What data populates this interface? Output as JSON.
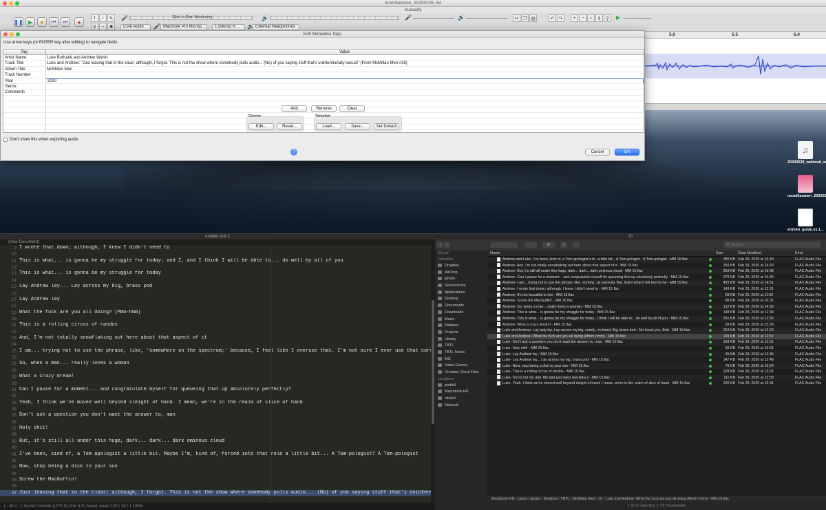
{
  "desktop": {
    "icons": [
      {
        "label": "20200229_waltwait_wwdlt...7067.mp3",
        "icon": "audio-file-icon"
      },
      {
        "label": "mcmillanmen_20200225_64.mp3",
        "icon": "audio-file-icon"
      },
      {
        "label": "elrmini_guide.v1.1...",
        "icon": "document-icon"
      }
    ]
  },
  "audacity": {
    "window_title": "mcmillanmen_20200225_64",
    "app_title": "Audacity",
    "monitor_label": "Click to Start Monitoring",
    "audio_host": "Core Audio",
    "recording_device": "MacBook Pro Microp...",
    "channels": "1 (Mono) R...",
    "playback_device": "External Headphones",
    "ruler": [
      "5.0",
      "5.5",
      "6.0"
    ]
  },
  "dialog": {
    "title": "Edit Metadata Tags",
    "instructions": "Use arrow keys (or ENTER key after editing) to navigate fields.",
    "col_tag": "Tag",
    "col_value": "Value",
    "rows": [
      {
        "tag": "Artist Name",
        "value": "Luke Burbank and Andrew Walsh"
      },
      {
        "tag": "Track Title",
        "value": "Luke and Andrew: \"Just leaving that in the clear; although, I forgot. This is not the show where somebody pulls audio... (No) of you saying stuff that's unintentionally sexual\" (From McMillan Men #15)"
      },
      {
        "tag": "Album Title",
        "value": "McMillan Men"
      },
      {
        "tag": "Track Number",
        "value": ""
      },
      {
        "tag": "Year",
        "value": "2020"
      },
      {
        "tag": "Genre",
        "value": ""
      },
      {
        "tag": "Comments",
        "value": ""
      }
    ],
    "add": "Add",
    "remove": "Remove",
    "clear": "Clear",
    "genres_label": "Genres",
    "edit": "Edit...",
    "reset": "Reset...",
    "template_label": "Template",
    "load": "Load...",
    "save": "Save...",
    "set_default": "Set Default",
    "dont_show": "Don't show this when exporting audio",
    "help": "?",
    "cancel": "Cancel",
    "ok": "OK"
  },
  "editor": {
    "title": "untitled text 2",
    "tab": "(New Document)",
    "lines": [
      {
        "n": "9",
        "t": "I wrote that down; although, I knew I didn't need to"
      },
      {
        "n": "10",
        "t": ""
      },
      {
        "n": "11",
        "t": "This is what... is gonna be my struggle for today; and I, and I think I will be able to... do well by all of you"
      },
      {
        "n": "12",
        "t": ""
      },
      {
        "n": "13",
        "t": "This is what... is gonna be my struggle for today"
      },
      {
        "n": "14",
        "t": ""
      },
      {
        "n": "15",
        "t": "Lay Andrew lay... Lay across my big, brass pod"
      },
      {
        "n": "16",
        "t": ""
      },
      {
        "n": "17",
        "t": "Lay Andrew lay"
      },
      {
        "n": "18",
        "t": ""
      },
      {
        "n": "19",
        "t": "What the fuck are you all doing? (Mmm-hmm)"
      },
      {
        "n": "20",
        "t": ""
      },
      {
        "n": "21",
        "t": "This is a rolling circus of randos"
      },
      {
        "n": "22",
        "t": ""
      },
      {
        "n": "23",
        "t": "And, I'm not totally snowflaking out here about that aspect of it"
      },
      {
        "n": "24",
        "t": ""
      },
      {
        "n": "25",
        "t": "I am... trying not to use the phrase, like, 'somewhere on the spectrum;' because, I feel like I overuse that. I'm not sure I ever use that correctly"
      },
      {
        "n": "26",
        "t": ""
      },
      {
        "n": "27",
        "t": "So, when a man... really loves a woman"
      },
      {
        "n": "28",
        "t": ""
      },
      {
        "n": "29",
        "t": "What a crazy dream!"
      },
      {
        "n": "30",
        "t": ""
      },
      {
        "n": "31",
        "t": "Can I pause for a moment... and congratulate myself for queueing that up absolutely perfectly?"
      },
      {
        "n": "32",
        "t": ""
      },
      {
        "n": "33",
        "t": "Yeah, I think we've moved well beyond sleight of hand. I mean, we're in the realm of slice of hand"
      },
      {
        "n": "34",
        "t": ""
      },
      {
        "n": "35",
        "t": "Don't ask a question you don't want the answer to, man"
      },
      {
        "n": "36",
        "t": ""
      },
      {
        "n": "37",
        "t": "Holy shit!"
      },
      {
        "n": "38",
        "t": ""
      },
      {
        "n": "39",
        "t": "But, it's still all under this huge,  dark... dark... dark ominous cloud"
      },
      {
        "n": "40",
        "t": ""
      },
      {
        "n": "41",
        "t": "I've been, kind of, a Tom apologist a little bit. Maybe I'm, kind of, forced into that role a little bit... A Tom-pologist? A Tom-pologist"
      },
      {
        "n": "42",
        "t": ""
      },
      {
        "n": "43",
        "t": "Now, stop being a dick to your son"
      },
      {
        "n": "44",
        "t": ""
      },
      {
        "n": "45",
        "t": "Screw the MacGuffin!"
      },
      {
        "n": "46",
        "t": ""
      },
      {
        "n": "47",
        "t": "Just leaving that in the clear; although, I forgot. This is not the show where somebody pulls audio... (No) of you saying stuff that's unintentional"
      }
    ],
    "status": "L: 46 C: 1    Jsonet    Unicode (UTF-8)    Unix (LF)    Never saved    137 / 28 / 1    100%"
  },
  "finder": {
    "title": "15",
    "search_placeholder": "Search",
    "sidebar": [
      {
        "type": "header",
        "label": "iCloud"
      },
      {
        "type": "header",
        "label": "Favorites"
      },
      {
        "type": "item",
        "label": "Dropbox"
      },
      {
        "type": "item",
        "label": "AirDrop"
      },
      {
        "type": "item",
        "label": "lpham"
      },
      {
        "type": "item",
        "label": "Screenshots"
      },
      {
        "type": "item",
        "label": "Applications"
      },
      {
        "type": "item",
        "label": "Desktop"
      },
      {
        "type": "item",
        "label": "Documents"
      },
      {
        "type": "item",
        "label": "Downloads"
      },
      {
        "type": "item",
        "label": "Music"
      },
      {
        "type": "item",
        "label": "Pictures"
      },
      {
        "type": "item",
        "label": "Projects"
      },
      {
        "type": "item",
        "label": "Library"
      },
      {
        "type": "item",
        "label": "TBTL"
      },
      {
        "type": "item",
        "label": "TBTL Notes"
      },
      {
        "type": "item",
        "label": "MG"
      },
      {
        "type": "item",
        "label": "Video Games"
      },
      {
        "type": "item",
        "label": "Creative Cloud Files"
      },
      {
        "type": "header",
        "label": "Locations"
      },
      {
        "type": "item",
        "label": "podhill"
      },
      {
        "type": "item",
        "label": "Macintosh HD"
      },
      {
        "type": "item",
        "label": "citadel"
      },
      {
        "type": "item",
        "label": "Network"
      }
    ],
    "columns": {
      "name": "Name",
      "size": "Size",
      "date": "Date Modified",
      "kind": "Kind"
    },
    "files": [
      {
        "name": "Andrew and Luke- I've been, kind of, a Tom apologist a lit...a little bit... A Tom-pologist - A Tom-pologist - MM 15.flac",
        "size": "285 KB",
        "date": "Feb 29, 2020 at 16:18",
        "kind": "FLAC Audio File"
      },
      {
        "name": "Andrew- And, I'm not totally snowflaking out here about that aspect of it - MM 15.flac",
        "size": "150 KB",
        "date": "Feb 29, 2020 at 14:20",
        "kind": "FLAC Audio File"
      },
      {
        "name": "Andrew- But, it's still all under this huge,  dark... dark... dark ominous cloud - MM 15.flac",
        "size": "263 KB",
        "date": "Feb 29, 2020 at 16:08",
        "kind": "FLAC Audio File"
      },
      {
        "name": "Andrew- Can I pause for a moment... and congratulate myself for queueing that up absolutely perfectly - MM 15.flac",
        "size": "270 KB",
        "date": "Feb 29, 2020 at 15:35",
        "kind": "FLAC Audio File"
      },
      {
        "name": "Andrew- I am... trying not to use the phrase, like, 'somew...at correctly. But, that's what it felt like to me - MM 15.flac",
        "size": "455 KB",
        "date": "Feb 29, 2020 at 14:51",
        "kind": "FLAC Audio File"
      },
      {
        "name": "Andrew- I wrote that down; although, I knew I didn't need to - MM 15.flac",
        "size": "143 KB",
        "date": "Feb 29, 2020 at 12:31",
        "kind": "FLAC Audio File"
      },
      {
        "name": "Andrew- It's too beautiful to live - MM 15.flac",
        "size": "58 KB",
        "date": "Feb 29, 2020 at 11:52",
        "kind": "FLAC Audio File"
      },
      {
        "name": "Andrew- Screw the MacGuffin! - MM 15.flac",
        "size": "88 KB",
        "date": "Feb 29, 2020 at 16:31",
        "kind": "FLAC Audio File"
      },
      {
        "name": "Andrew- So, when a man... really loves a woman - MM 15.flac",
        "size": "112 KB",
        "date": "Feb 29, 2020 at 14:59",
        "kind": "FLAC Audio File"
      },
      {
        "name": "Andrew- This is what... is gonna be my struggle for today - MM 15.flac",
        "size": "148 KB",
        "date": "Feb 29, 2020 at 12:39",
        "kind": "FLAC Audio File"
      },
      {
        "name": "Andrew- This is what... is gonna be my struggle for today...I think I will be able to... do well by all of you - MM 15.flac",
        "size": "291 KB",
        "date": "Feb 29, 2020 at 12:36",
        "kind": "FLAC Audio File"
      },
      {
        "name": "Andrew- What a crazy dream! - MM 15.flac",
        "size": "69 KB",
        "date": "Feb 29, 2020 at 15:30",
        "kind": "FLAC Audio File"
      },
      {
        "name": "Luke and Andrew- Lay lady lay. Lay across my big, comfy...m-hmm) Big, brass bed - No thank you, Bob - MM 15.flac",
        "size": "263 KB",
        "date": "Feb 29, 2020 at 12:20",
        "kind": "FLAC Audio File"
      },
      {
        "name": "Luke and Andrew- What the fuck are you all doing (Mmm-hmm) - MM 15.flac",
        "size": "109 KB",
        "date": "Feb 29, 2020 at 12:57",
        "kind": "FLAC Audio File",
        "selected": true
      },
      {
        "name": "Luke- Don't ask a question you don't want the answer to, man - MM 15.flac",
        "size": "109 KB",
        "date": "Feb 29, 2020 at 15:51",
        "kind": "FLAC Audio File"
      },
      {
        "name": "Luke- Holy shit! - MM 15.flac",
        "size": "55 KB",
        "date": "Feb 29, 2020 at 16:01",
        "kind": "FLAC Audio File"
      },
      {
        "name": "Luke- Lay Andrew lay - MM 15.flac",
        "size": "39 KB",
        "date": "Feb 29, 2020 at 12:46",
        "kind": "FLAC Audio File"
      },
      {
        "name": "Luke- Lay Andrew lay... Lay across my big, brass pod - MM 15.flac",
        "size": "147 KB",
        "date": "Feb 29, 2020 at 12:49",
        "kind": "FLAC Audio File"
      },
      {
        "name": "Luke- Now, stop being a dick to your son - MM 15.flac",
        "size": "79 KB",
        "date": "Feb 29, 2020 at 16:24",
        "kind": "FLAC Audio File"
      },
      {
        "name": "Luke- This is a rolling circus of randos - MM 15.flac",
        "size": "128 KB",
        "date": "Feb 29, 2020 at 13:01",
        "kind": "FLAC Audio File"
      },
      {
        "name": "Luke- Tom's not my dad. My dad just owns two Arby's - MM 15.flac",
        "size": "111 KB",
        "date": "Feb 29, 2020 at 12:33",
        "kind": "FLAC Audio File"
      },
      {
        "name": "Luke- Yeah, I think we've moved well beyond sleight of hand. I mean, we're in the realm of slice of hand - MM 15.flac",
        "size": "200 KB",
        "date": "Feb 29, 2020 at 15:41",
        "kind": "FLAC Audio File"
      }
    ],
    "path": "Macintosh HD  ›  Users  ›  lpham  ›  Dropbox  ›  TBTL  ›  McMillan Men  ›  15  ›  Luke and Andrew- What the fuck are you all doing (Mmm-hmm) - MM 15.flac",
    "status": "1 of 22 selected, 1.73 TB available"
  }
}
